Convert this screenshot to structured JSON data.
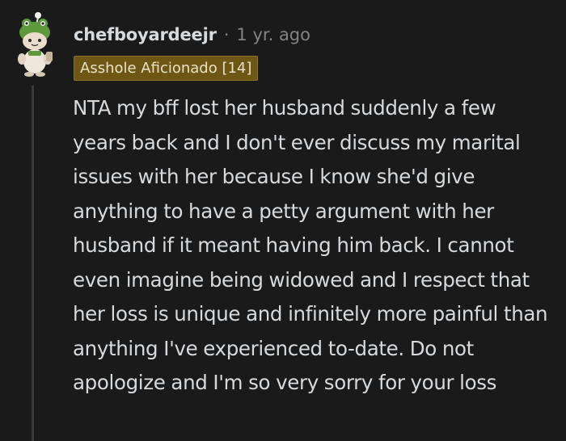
{
  "comment": {
    "username": "chefboyardeejr",
    "separator": "·",
    "age": "1 yr. ago",
    "flair": "Asshole Aficionado [14]",
    "text": "NTA my bff lost her husband suddenly a few years back and I don't ever discuss my marital issues with her because I know she'd give anything to have a petty argument with her husband if it meant having him back. I cannot even imagine being widowed and I respect that her loss is unique and infinitely more painful than anything I've experienced to-date. Do not apologize and I'm so very sorry for your loss"
  },
  "avatar": {
    "icon": "snoo-avatar-icon",
    "description_colors": {
      "hat": "#5a8f3a",
      "face": "#e9dcc9"
    }
  },
  "colors": {
    "background": "#1a1a1b",
    "text": "#d7dadc",
    "muted": "#818384",
    "flair_bg": "#6e5614",
    "thread_line": "#3a3a3c"
  }
}
